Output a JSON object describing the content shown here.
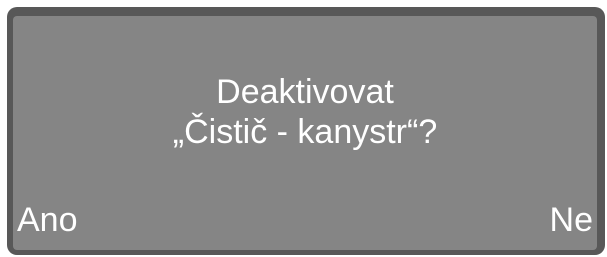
{
  "dialog": {
    "line1": "Deaktivovat",
    "line2": "„Čistič - kanystr“?"
  },
  "softkeys": {
    "left_label": "Ano",
    "right_label": "Ne"
  },
  "colors": {
    "bezel": "#585858",
    "screen": "#858585",
    "text": "#ffffff"
  }
}
